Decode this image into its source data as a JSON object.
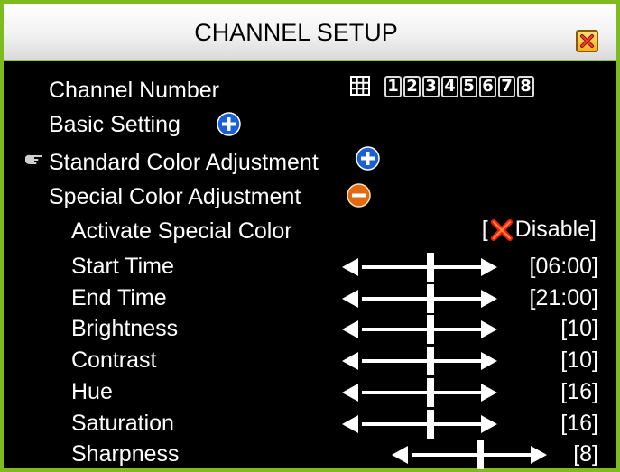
{
  "window": {
    "title": "CHANNEL SETUP"
  },
  "channel": {
    "label": "Channel Number",
    "buttons": [
      "1",
      "2",
      "3",
      "4",
      "5",
      "6",
      "7",
      "8"
    ]
  },
  "menu": {
    "basic": "Basic Setting",
    "standard": "Standard Color Adjustment",
    "special": "Special Color Adjustment"
  },
  "special": {
    "activate_label": "Activate Special Color",
    "activate_value": "Disable",
    "rows": [
      {
        "label": "Start Time",
        "value": "[06:00]"
      },
      {
        "label": "End Time",
        "value": "[21:00]"
      },
      {
        "label": "Brightness",
        "value": "[10]"
      },
      {
        "label": "Contrast",
        "value": "[10]"
      },
      {
        "label": "Hue",
        "value": "[16]"
      },
      {
        "label": "Saturation",
        "value": "[16]"
      },
      {
        "label": "Sharpness",
        "value": "[8]"
      }
    ]
  },
  "colors": {
    "border": "#7dbb1e",
    "plus_blue": "#1a5fd6",
    "minus_orange": "#e06a10",
    "x_red": "#ff2000"
  },
  "icons": {
    "close": "close-icon",
    "plus": "plus-circle-icon",
    "minus": "minus-circle-icon",
    "pointer": "pointing-hand-icon",
    "grid": "grid-icon"
  }
}
